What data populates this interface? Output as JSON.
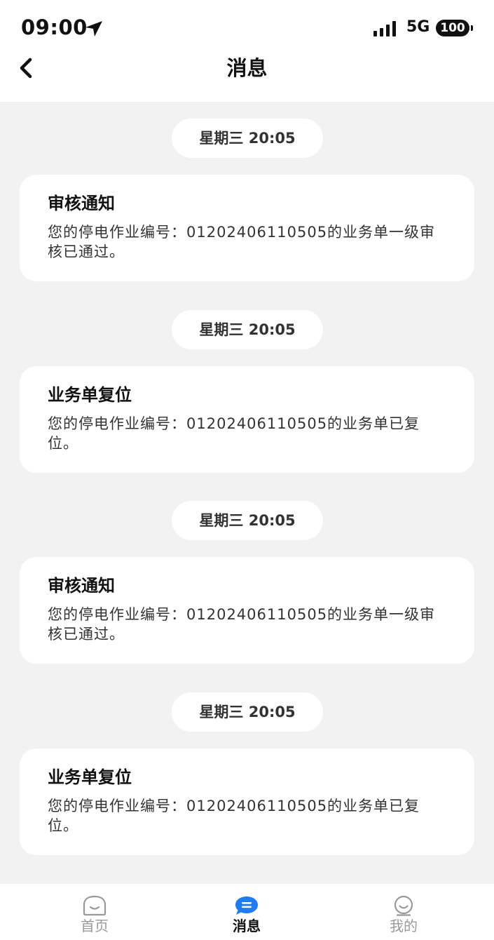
{
  "status_bar": {
    "time": "09:00",
    "network": "5G",
    "battery": "100"
  },
  "header": {
    "title": "消息"
  },
  "messages": [
    {
      "time": "星期三 20:05",
      "title": "审核通知",
      "body": "您的停电作业编号：01202406110505的业务单一级审核已通过。"
    },
    {
      "time": "星期三 20:05",
      "title": "业务单复位",
      "body": "您的停电作业编号：01202406110505的业务单已复位。"
    },
    {
      "time": "星期三 20:05",
      "title": "审核通知",
      "body": "您的停电作业编号：01202406110505的业务单一级审核已通过。"
    },
    {
      "time": "星期三 20:05",
      "title": "业务单复位",
      "body": "您的停电作业编号：01202406110505的业务单已复位。"
    }
  ],
  "tabs": [
    {
      "label": "首页",
      "icon": "home-face-icon",
      "active": false
    },
    {
      "label": "消息",
      "icon": "chat-bubble-icon",
      "active": true
    },
    {
      "label": "我的",
      "icon": "profile-face-icon",
      "active": false
    }
  ],
  "colors": {
    "accent": "#1e7cf2",
    "background": "#f2f2f2",
    "inactive_tab": "#999999"
  }
}
